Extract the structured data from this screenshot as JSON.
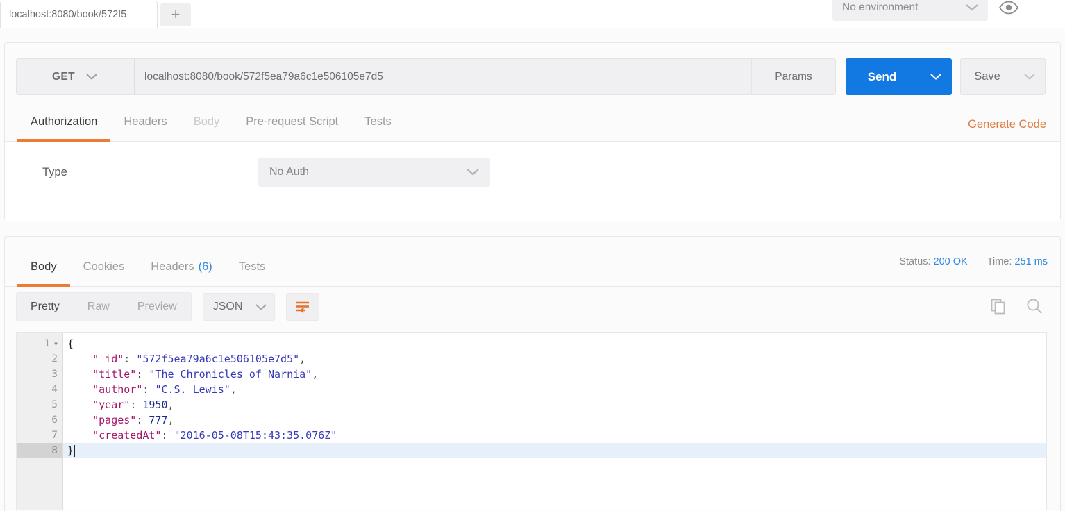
{
  "topbar": {
    "request_tab_label": "localhost:8080/book/572f5",
    "new_tab_label": "+",
    "environment_selected": "No environment",
    "eye_icon": "eye-icon"
  },
  "request": {
    "method": "GET",
    "url": "localhost:8080/book/572f5ea79a6c1e506105e7d5",
    "params_label": "Params",
    "send_label": "Send",
    "save_label": "Save",
    "generate_code_label": "Generate Code",
    "tabs": [
      {
        "label": "Authorization",
        "active": true,
        "disabled": false
      },
      {
        "label": "Headers",
        "active": false,
        "disabled": false
      },
      {
        "label": "Body",
        "active": false,
        "disabled": true
      },
      {
        "label": "Pre-request Script",
        "active": false,
        "disabled": false
      },
      {
        "label": "Tests",
        "active": false,
        "disabled": false
      }
    ],
    "auth": {
      "type_label": "Type",
      "type_value": "No Auth"
    }
  },
  "response": {
    "tabs": [
      {
        "label": "Body",
        "active": true,
        "count": ""
      },
      {
        "label": "Cookies",
        "active": false,
        "count": ""
      },
      {
        "label": "Headers",
        "active": false,
        "count": "(6)"
      },
      {
        "label": "Tests",
        "active": false,
        "count": ""
      }
    ],
    "status_label": "Status:",
    "status_value": "200 OK",
    "time_label": "Time:",
    "time_value": "251 ms",
    "view_modes": [
      {
        "label": "Pretty",
        "active": true
      },
      {
        "label": "Raw",
        "active": false
      },
      {
        "label": "Preview",
        "active": false
      }
    ],
    "format_selected": "JSON",
    "wrap_icon": "word-wrap-icon",
    "copy_icon": "copy-icon",
    "search_icon": "search-icon",
    "body_lines": [
      {
        "num": "1",
        "fold": true,
        "current": false,
        "tokens": [
          {
            "t": "br",
            "v": "{"
          }
        ]
      },
      {
        "num": "2",
        "fold": false,
        "current": false,
        "tokens": [
          {
            "t": "k",
            "v": "    \"_id\""
          },
          {
            "t": "p",
            "v": ": "
          },
          {
            "t": "s",
            "v": "\"572f5ea79a6c1e506105e7d5\""
          },
          {
            "t": "p",
            "v": ","
          }
        ]
      },
      {
        "num": "3",
        "fold": false,
        "current": false,
        "tokens": [
          {
            "t": "k",
            "v": "    \"title\""
          },
          {
            "t": "p",
            "v": ": "
          },
          {
            "t": "s",
            "v": "\"The Chronicles of Narnia\""
          },
          {
            "t": "p",
            "v": ","
          }
        ]
      },
      {
        "num": "4",
        "fold": false,
        "current": false,
        "tokens": [
          {
            "t": "k",
            "v": "    \"author\""
          },
          {
            "t": "p",
            "v": ": "
          },
          {
            "t": "s",
            "v": "\"C.S. Lewis\""
          },
          {
            "t": "p",
            "v": ","
          }
        ]
      },
      {
        "num": "5",
        "fold": false,
        "current": false,
        "tokens": [
          {
            "t": "k",
            "v": "    \"year\""
          },
          {
            "t": "p",
            "v": ": "
          },
          {
            "t": "n",
            "v": "1950"
          },
          {
            "t": "p",
            "v": ","
          }
        ]
      },
      {
        "num": "6",
        "fold": false,
        "current": false,
        "tokens": [
          {
            "t": "k",
            "v": "    \"pages\""
          },
          {
            "t": "p",
            "v": ": "
          },
          {
            "t": "n",
            "v": "777"
          },
          {
            "t": "p",
            "v": ","
          }
        ]
      },
      {
        "num": "7",
        "fold": false,
        "current": false,
        "tokens": [
          {
            "t": "k",
            "v": "    \"createdAt\""
          },
          {
            "t": "p",
            "v": ": "
          },
          {
            "t": "s",
            "v": "\"2016-05-08T15:43:35.076Z\""
          }
        ]
      },
      {
        "num": "8",
        "fold": false,
        "current": true,
        "tokens": [
          {
            "t": "br",
            "v": "}"
          }
        ],
        "caret": true
      }
    ],
    "json_body": {
      "_id": "572f5ea79a6c1e506105e7d5",
      "title": "The Chronicles of Narnia",
      "author": "C.S. Lewis",
      "year": 1950,
      "pages": 777,
      "createdAt": "2016-05-08T15:43:35.076Z"
    }
  },
  "colors": {
    "accent_orange": "#ec7b34",
    "send_blue": "#1279e3",
    "link_blue": "#2f88e0",
    "json_key": "#a6186d",
    "json_string": "#3739b8",
    "json_number": "#1d2b8f"
  }
}
